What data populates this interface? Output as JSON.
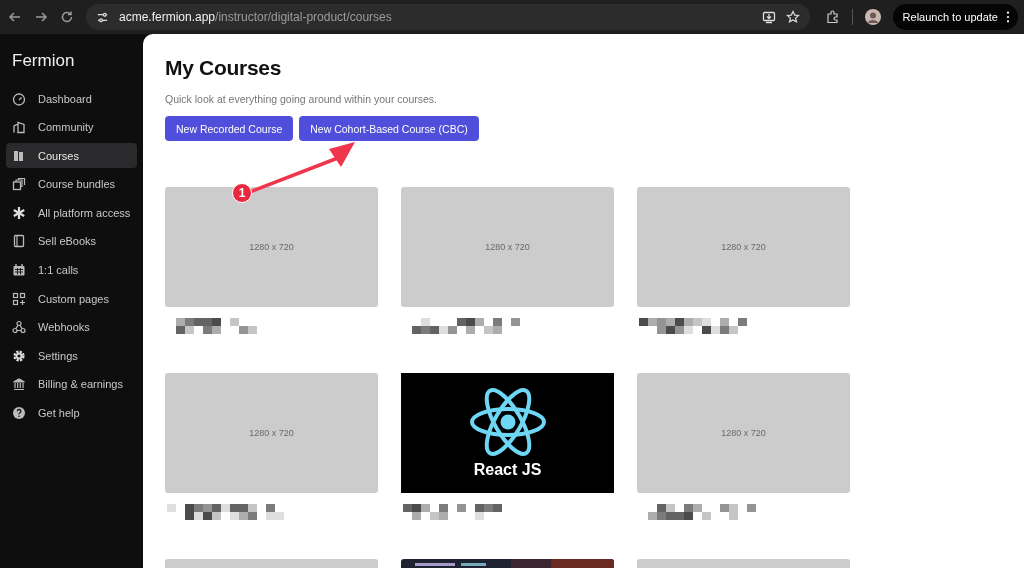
{
  "browser": {
    "url_host": "acme.fermion.app",
    "url_path": "/instructor/digital-product/courses",
    "update_button": "Relaunch to update"
  },
  "sidebar": {
    "brand": "Fermion",
    "items": [
      {
        "label": "Dashboard",
        "selected": false
      },
      {
        "label": "Community",
        "selected": false
      },
      {
        "label": "Courses",
        "selected": true
      },
      {
        "label": "Course bundles",
        "selected": false
      },
      {
        "label": "All platform access",
        "selected": false
      },
      {
        "label": "Sell eBooks",
        "selected": false
      },
      {
        "label": "1:1 calls",
        "selected": false
      },
      {
        "label": "Custom pages",
        "selected": false
      },
      {
        "label": "Webhooks",
        "selected": false
      },
      {
        "label": "Settings",
        "selected": false
      },
      {
        "label": "Billing & earnings",
        "selected": false
      },
      {
        "label": "Get help",
        "selected": false
      }
    ]
  },
  "page": {
    "title": "My Courses",
    "subtitle": "Quick look at everything going around within your courses.",
    "buttons": [
      "New Recorded Course",
      "New Cohort-Based Course (CBC)"
    ]
  },
  "annotation": {
    "badge": "1"
  },
  "courses": [
    {
      "kind": "placeholder",
      "label": "1280 x 720"
    },
    {
      "kind": "placeholder",
      "label": "1280 x 720"
    },
    {
      "kind": "placeholder",
      "label": "1280 x 720"
    },
    {
      "kind": "placeholder",
      "label": "1280 x 720"
    },
    {
      "kind": "cover",
      "cover_text": "React JS"
    },
    {
      "kind": "placeholder",
      "label": "1280 x 720"
    },
    {
      "kind": "placeholder"
    },
    {
      "kind": "picture"
    },
    {
      "kind": "placeholder"
    }
  ]
}
